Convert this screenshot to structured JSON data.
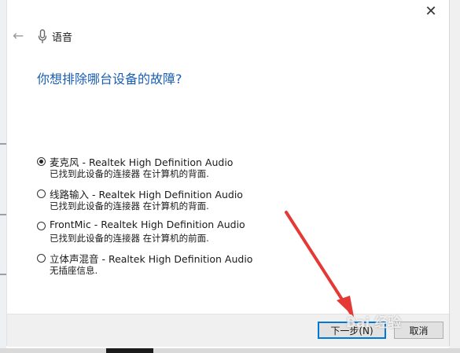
{
  "window": {
    "close_glyph": "✕"
  },
  "header": {
    "back_icon": "back-arrow-icon",
    "app_icon": "microphone-icon",
    "title": "语音"
  },
  "question": "你想排除哪台设备的故障?",
  "devices": [
    {
      "name": "麦克风 - Realtek High Definition Audio",
      "description": "已找到此设备的连接器 在计算机的背面.",
      "selected": true
    },
    {
      "name": "线路输入 - Realtek High Definition Audio",
      "description": "已找到此设备的连接器 在计算机的背面.",
      "selected": false
    },
    {
      "name": "FrontMic - Realtek High Definition Audio",
      "description": "已找到此设备的连接器 在计算机的前面.",
      "selected": false
    },
    {
      "name": "立体声混音 - Realtek High Definition Audio",
      "description": "无插座信息.",
      "selected": false
    }
  ],
  "footer": {
    "next_label": "下一步(N)",
    "cancel_label": "取消"
  },
  "watermark": "Bai 经验",
  "colors": {
    "question_blue": "#1a5fb4",
    "focus_border": "#0078d7",
    "annotation_arrow": "#e53935"
  }
}
